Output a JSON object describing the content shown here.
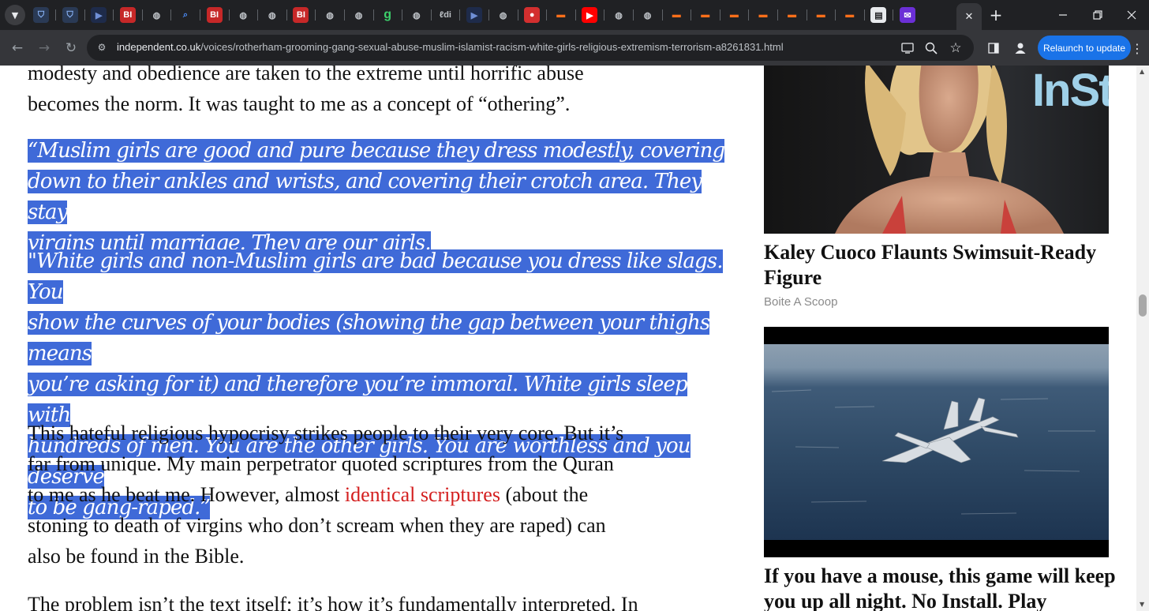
{
  "browser": {
    "tab_strip_button": "tab-search",
    "favicons": [
      "shield",
      "shield",
      "slides",
      "bi",
      "globe",
      "search",
      "bi",
      "globe",
      "globe",
      "bi",
      "globe",
      "globe",
      "g",
      "globe",
      "ldi",
      "slides",
      "globe",
      "mic",
      "bookmark",
      "youtube",
      "globe",
      "globe",
      "bookmark",
      "bookmark",
      "bookmark",
      "bookmark",
      "bookmark",
      "bookmark",
      "bookmark",
      "news",
      "mail"
    ],
    "favicon_text": {
      "bi": "BI",
      "g": "g",
      "ldi": "ℓdi"
    },
    "active_tab_close": "✕",
    "new_tab": "+",
    "url_host": "independent.co.uk",
    "url_path": "/voices/rotherham-grooming-gang-sexual-abuse-muslim-islamist-racism-white-girls-religious-extremism-terrorism-a8261831.html",
    "relaunch_label": "Relaunch to update",
    "accent_color": "#1a73e8"
  },
  "article": {
    "para1_line1": "modesty and obedience are taken to the extreme until horrific abuse",
    "para1_line2": "becomes the norm. It was taught to me as a concept of “othering”.",
    "quote1": [
      "“Muslim girls are good and pure because they dress modestly, covering",
      "down to their ankles and wrists, and covering their crotch area. They stay",
      "virgins until marriage. They are our girls."
    ],
    "quote2": [
      "\"White girls and non-Muslim girls are bad because you dress like slags. You",
      "show the curves of your bodies (showing the gap between your thighs means",
      "you’re asking for it) and therefore you’re immoral. White girls sleep with",
      "hundreds of men. You are the other girls. You are worthless and you deserve",
      "to be gang-raped.”"
    ],
    "para3_line1": "This hateful religious hypocrisy strikes people to their very core. But it’s",
    "para3_line2": "far from unique. My main perpetrator quoted scriptures from the Quran",
    "para3_line3_before": "to me as he beat me. However, almost ",
    "para3_link": "identical scriptures",
    "para3_line3_after": " (about the",
    "para3_line4": "stoning to death of virgins who don’t scream when they are raped) can",
    "para3_line5": "also be found in the Bible.",
    "para4_line1": "The problem isn’t the text itself; it’s how it’s fundamentally interpreted. In",
    "highlight_color": "#3f6ad8",
    "link_color": "#d41f1f"
  },
  "sidebar": {
    "ad1": {
      "image_text": "InSt",
      "title": "Kaley Cuoco Flaunts Swimsuit-Ready Figure",
      "source": "Boite A Scoop"
    },
    "ad2": {
      "title": "If you have a mouse, this game will keep you up all night. No Install. Play"
    }
  }
}
